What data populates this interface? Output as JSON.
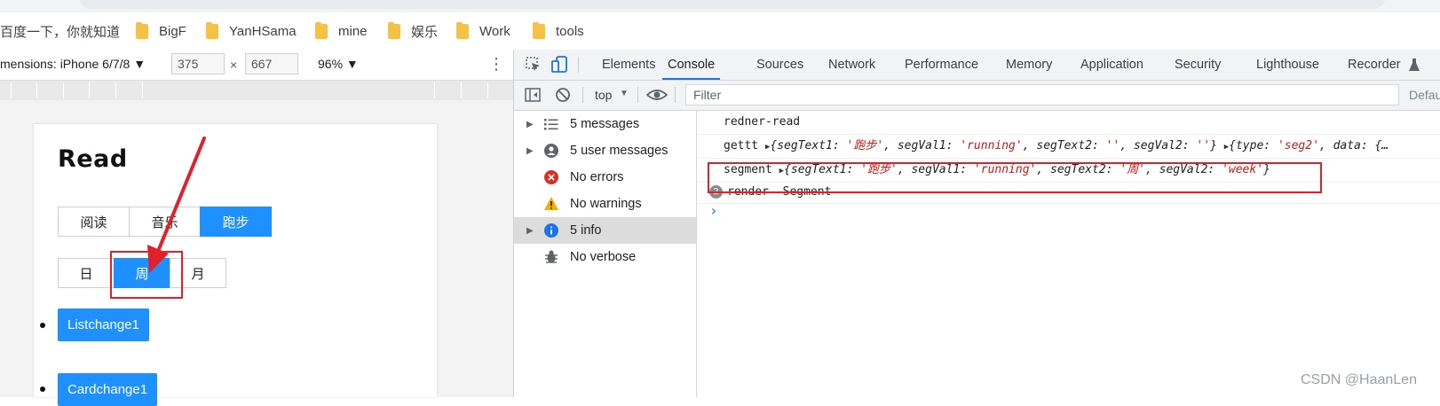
{
  "bookmarks": [
    {
      "label": "百度一下，你就知道",
      "folder": false
    },
    {
      "label": "BigF",
      "folder": true
    },
    {
      "label": "YanHSama",
      "folder": true
    },
    {
      "label": "mine",
      "folder": true
    },
    {
      "label": "娱乐",
      "folder": true
    },
    {
      "label": "Work",
      "folder": true
    },
    {
      "label": "tools",
      "folder": true
    }
  ],
  "device_toolbar": {
    "dimensions_label": "mensions: iPhone 6/7/8 ▼",
    "width": "375",
    "times": "×",
    "height": "667",
    "zoom": "96% ▼",
    "more": "⋮"
  },
  "page": {
    "title": "Read",
    "tabs1": [
      {
        "label": "阅读",
        "active": false
      },
      {
        "label": "音乐",
        "active": false
      },
      {
        "label": "跑步",
        "active": true
      }
    ],
    "tabs2": [
      {
        "label": "日",
        "active": false
      },
      {
        "label": "周",
        "active": true
      },
      {
        "label": "月",
        "active": false
      }
    ],
    "list": [
      "Listchange1",
      "Cardchange1"
    ]
  },
  "devtools": {
    "tabs": [
      {
        "label": "Elements",
        "active": false
      },
      {
        "label": "Console",
        "active": true
      },
      {
        "label": "Sources",
        "active": false
      },
      {
        "label": "Network",
        "active": false
      },
      {
        "label": "Performance",
        "active": false
      },
      {
        "label": "Memory",
        "active": false
      },
      {
        "label": "Application",
        "active": false
      },
      {
        "label": "Security",
        "active": false
      },
      {
        "label": "Lighthouse",
        "active": false
      },
      {
        "label": "Recorder",
        "active": false
      }
    ],
    "context": "top",
    "filter_placeholder": "Filter",
    "default_levels": "Defau",
    "sidebar": [
      {
        "label": "5 messages",
        "icon": "list-icon",
        "expand": true,
        "selected": false
      },
      {
        "label": "5 user messages",
        "icon": "user-icon",
        "expand": true,
        "selected": false
      },
      {
        "label": "No errors",
        "icon": "error-icon",
        "expand": false,
        "selected": false
      },
      {
        "label": "No warnings",
        "icon": "warning-icon",
        "expand": false,
        "selected": false
      },
      {
        "label": "5 info",
        "icon": "info-icon",
        "expand": true,
        "selected": true
      },
      {
        "label": "No verbose",
        "icon": "bug-icon",
        "expand": false,
        "selected": false
      }
    ],
    "console": {
      "row1": "redner-read",
      "row2": {
        "label": "gettt",
        "k1": "segText1",
        "v1": "'跑步'",
        "k2": "segVal1",
        "v2": "'running'",
        "k3": "segText2",
        "v3": "''",
        "k4": "segVal2",
        "v4": "''",
        "k5": "type",
        "v5": "'seg2'",
        "k6": "data",
        "tail": "{…"
      },
      "row3": {
        "label": "segment",
        "k1": "segText1",
        "v1": "'跑步'",
        "k2": "segVal1",
        "v2": "'running'",
        "k3": "segText2",
        "v3": "'周'",
        "k4": "segVal2",
        "v4": "'week'"
      },
      "row4": {
        "count": "2",
        "text": "render--Segment"
      },
      "prompt": "›"
    }
  },
  "watermark": "CSDN @HaanLen",
  "colors": {
    "accent": "#1e90ff",
    "highlight": "#e0212a",
    "devtools_active": "#1a73e8"
  }
}
